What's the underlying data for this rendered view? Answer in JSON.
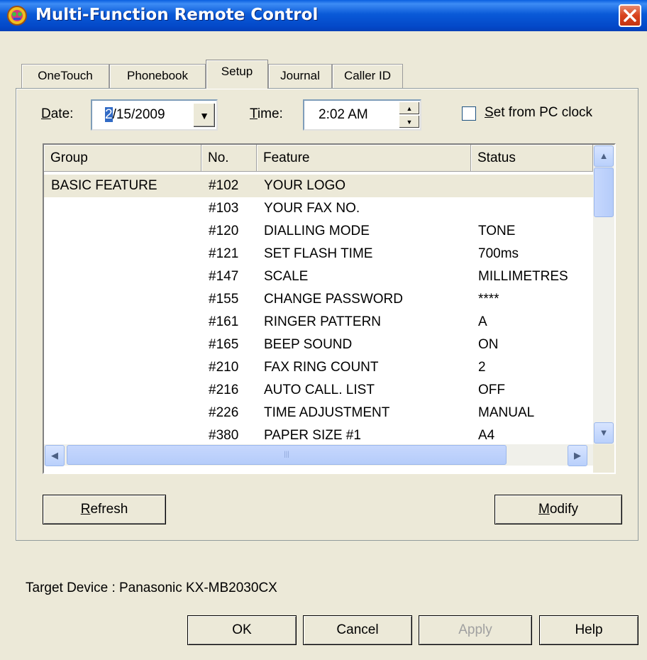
{
  "window": {
    "title": "Multi-Function Remote Control"
  },
  "tabs": [
    {
      "label": "OneTouch"
    },
    {
      "label": "Phonebook"
    },
    {
      "label": "Setup",
      "active": true
    },
    {
      "label": "Journal"
    },
    {
      "label": "Caller ID"
    }
  ],
  "date": {
    "label": "Date:",
    "value_selected": "2",
    "value_rest": "/15/2009"
  },
  "time": {
    "label": "Time:",
    "value": "2:02 AM"
  },
  "pc_clock": {
    "label": "Set from PC clock",
    "checked": false
  },
  "list": {
    "columns": [
      "Group",
      "No.",
      "Feature",
      "Status"
    ],
    "rows": [
      {
        "group": "BASIC FEATURE",
        "no": "#102",
        "feature": "YOUR LOGO",
        "status": ""
      },
      {
        "group": "",
        "no": "#103",
        "feature": "YOUR FAX NO.",
        "status": ""
      },
      {
        "group": "",
        "no": "#120",
        "feature": "DIALLING MODE",
        "status": "TONE"
      },
      {
        "group": "",
        "no": "#121",
        "feature": "SET FLASH TIME",
        "status": "700ms"
      },
      {
        "group": "",
        "no": "#147",
        "feature": "SCALE",
        "status": "MILLIMETRES"
      },
      {
        "group": "",
        "no": "#155",
        "feature": "CHANGE PASSWORD",
        "status": "****"
      },
      {
        "group": "",
        "no": "#161",
        "feature": "RINGER PATTERN",
        "status": "A"
      },
      {
        "group": "",
        "no": "#165",
        "feature": "BEEP SOUND",
        "status": "ON"
      },
      {
        "group": "",
        "no": "#210",
        "feature": "FAX RING COUNT",
        "status": "2"
      },
      {
        "group": "",
        "no": "#216",
        "feature": "AUTO CALL. LIST",
        "status": "OFF"
      },
      {
        "group": "",
        "no": "#226",
        "feature": "TIME ADJUSTMENT",
        "status": "MANUAL"
      },
      {
        "group": "",
        "no": "#380",
        "feature": "PAPER SIZE #1",
        "status": "A4"
      }
    ]
  },
  "buttons": {
    "refresh": "Refresh",
    "modify": "Modify",
    "ok": "OK",
    "cancel": "Cancel",
    "apply": "Apply",
    "help": "Help"
  },
  "status": {
    "target_device": "Target Device : Panasonic KX-MB2030CX"
  },
  "colors": {
    "title_bar": "#0a5ad8",
    "selection": "#316ac5",
    "dialog_bg": "#ece9d8"
  }
}
